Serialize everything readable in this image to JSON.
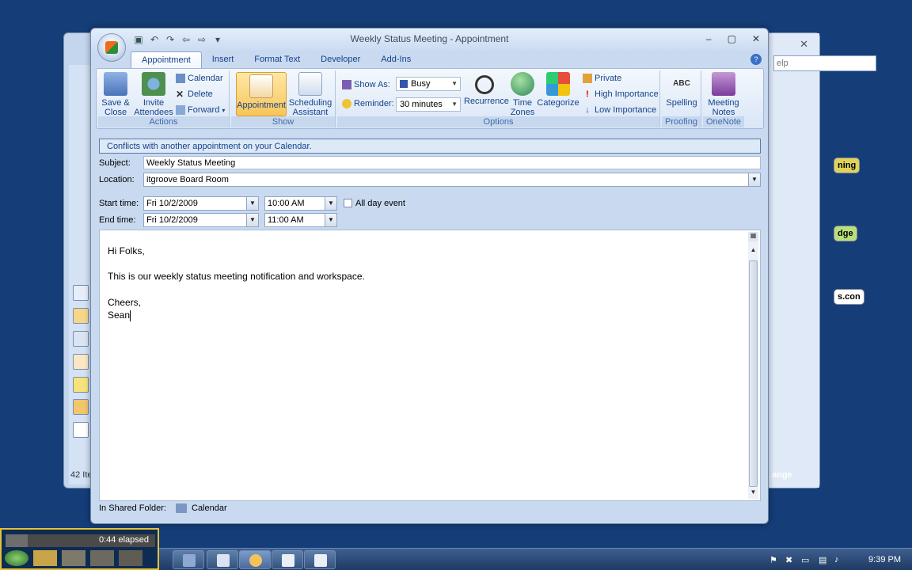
{
  "window": {
    "title": "Weekly Status Meeting - Appointment"
  },
  "ribbon": {
    "tabs": [
      "Appointment",
      "Insert",
      "Format Text",
      "Developer",
      "Add-Ins"
    ],
    "groups": {
      "actions": {
        "label": "Actions",
        "save_close": [
          "Save &",
          "Close"
        ],
        "invite": [
          "Invite",
          "Attendees"
        ],
        "calendar": "Calendar",
        "delete": "Delete",
        "forward": "Forward"
      },
      "show": {
        "label": "Show",
        "appointment": "Appointment",
        "scheduling": [
          "Scheduling",
          "Assistant"
        ]
      },
      "options": {
        "label": "Options",
        "show_as_label": "Show As:",
        "show_as_value": "Busy",
        "reminder_label": "Reminder:",
        "reminder_value": "30 minutes",
        "recurrence": "Recurrence",
        "time_zones": [
          "Time",
          "Zones"
        ],
        "categorize": "Categorize",
        "private": "Private",
        "high_importance": "High Importance",
        "low_importance": "Low Importance"
      },
      "proofing": {
        "label": "Proofing",
        "spelling": "Spelling"
      },
      "onenote": {
        "label": "OneNote",
        "meeting_notes": [
          "Meeting",
          "Notes"
        ]
      }
    }
  },
  "form": {
    "infobar": "Conflicts with another appointment on your Calendar.",
    "subject_label": "Subject:",
    "subject_value": "Weekly Status Meeting",
    "location_label": "Location:",
    "location_value": "itgroove Board Room",
    "start_label": "Start time:",
    "start_date": "Fri 10/2/2009",
    "start_time": "10:00 AM",
    "all_day_label": "All day event",
    "end_label": "End time:",
    "end_date": "Fri 10/2/2009",
    "end_time": "11:00 AM",
    "body_lines": [
      "Hi Folks,",
      "This is our weekly status meeting notification and workspace.",
      "Cheers,",
      "Sean"
    ],
    "shared_folder_label": "In Shared Folder:",
    "shared_folder_value": "Calendar"
  },
  "background_window": {
    "help_text": "elp",
    "pill_1": "ning",
    "pill_2": "dge",
    "pill_3": "s.con",
    "items_count": "42 Ite",
    "arrange": "ange"
  },
  "overlay": {
    "elapsed": "0:44 elapsed",
    "elapsed_fraction": 0.15
  },
  "taskbar": {
    "clock": "9:39 PM"
  }
}
